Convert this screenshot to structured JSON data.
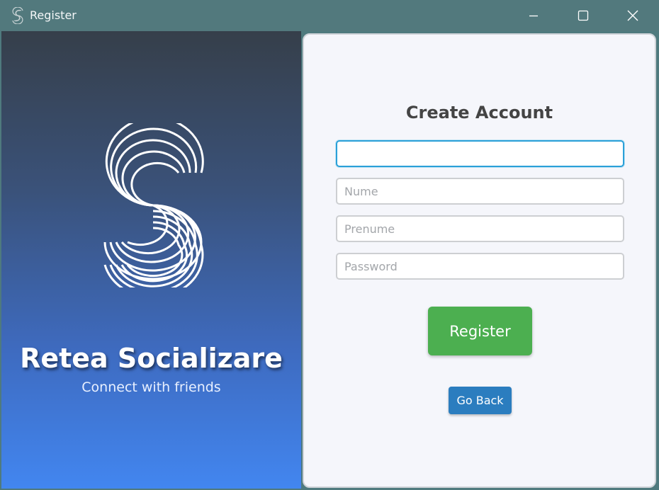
{
  "window": {
    "title": "Register",
    "app_icon": "s-logo-icon",
    "controls": [
      "minimize-icon",
      "maximize-icon",
      "close-icon"
    ]
  },
  "brand": {
    "logo_icon": "s-lines-logo",
    "name": "Retea Socializare",
    "tagline": "Connect with friends"
  },
  "form": {
    "title": "Create Account",
    "fields": [
      {
        "value": "",
        "placeholder": "",
        "focused": true
      },
      {
        "value": "",
        "placeholder": "Nume"
      },
      {
        "value": "",
        "placeholder": "Prenume"
      },
      {
        "value": "",
        "placeholder": "Password"
      }
    ],
    "register_label": "Register",
    "back_label": "Go Back"
  },
  "colors": {
    "titlebar": "#52797d",
    "gradient_top": "#363f4a",
    "gradient_bottom": "#4286f0",
    "register_button": "#4caf50",
    "back_button": "#2b7dbf",
    "focus_border": "#2ba0d8"
  }
}
